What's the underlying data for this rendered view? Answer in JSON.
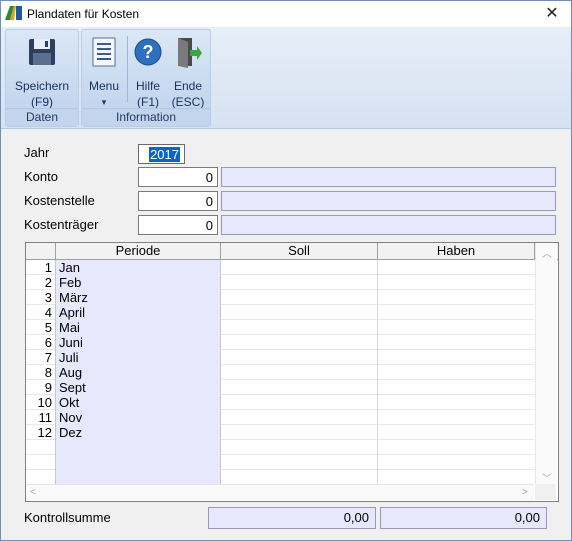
{
  "window": {
    "title": "Plandaten für Kosten",
    "close_symbol": "✕"
  },
  "ribbon": {
    "groups": [
      {
        "label": "Daten",
        "buttons": [
          {
            "label": "Speichern",
            "shortcut": "(F9)",
            "icon": "save-icon"
          }
        ]
      },
      {
        "label": "Information",
        "buttons": [
          {
            "label": "Menu",
            "shortcut": "▾",
            "icon": "menu-icon"
          },
          {
            "label": "Hilfe",
            "shortcut": "(F1)",
            "icon": "help-icon"
          },
          {
            "label": "Ende",
            "shortcut": "(ESC)",
            "icon": "exit-icon"
          }
        ]
      }
    ]
  },
  "form": {
    "jahr": {
      "label": "Jahr",
      "value": "2017"
    },
    "konto": {
      "label": "Konto",
      "value": "0"
    },
    "kostenstelle": {
      "label": "Kostenstelle",
      "value": "0"
    },
    "kostentraeger": {
      "label": "Kostenträger",
      "value": "0"
    }
  },
  "table": {
    "columns": [
      "Periode",
      "Soll",
      "Haben"
    ],
    "rows": [
      {
        "num": "1",
        "periode": "Jan"
      },
      {
        "num": "2",
        "periode": "Feb"
      },
      {
        "num": "3",
        "periode": "März"
      },
      {
        "num": "4",
        "periode": "April"
      },
      {
        "num": "5",
        "periode": "Mai"
      },
      {
        "num": "6",
        "periode": "Juni"
      },
      {
        "num": "7",
        "periode": "Juli"
      },
      {
        "num": "8",
        "periode": "Aug"
      },
      {
        "num": "9",
        "periode": "Sept"
      },
      {
        "num": "10",
        "periode": "Okt"
      },
      {
        "num": "11",
        "periode": "Nov"
      },
      {
        "num": "12",
        "periode": "Dez"
      },
      {
        "num": "",
        "periode": ""
      },
      {
        "num": "",
        "periode": ""
      },
      {
        "num": "",
        "periode": ""
      }
    ]
  },
  "footer": {
    "label": "Kontrollsumme",
    "soll_sum": "0,00",
    "haben_sum": "0,00"
  },
  "colors": {
    "accent": "#0b64c8",
    "lookup_bg": "#e8e8fc",
    "ribbon": "#c6d8ef"
  }
}
